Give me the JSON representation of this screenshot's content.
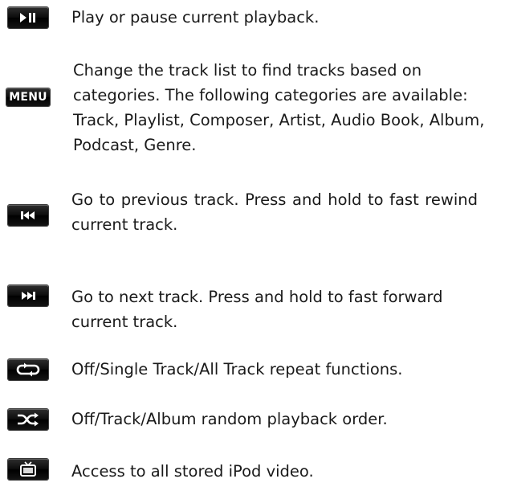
{
  "items": [
    {
      "key": "play_pause",
      "icon": "play-pause-icon",
      "text": "Play or pause current playback."
    },
    {
      "key": "menu",
      "icon": "menu-icon",
      "icon_label": "MENU",
      "text_line1": "Change the track list to find tracks based on",
      "text_rest": "categories. The following categories are available: Track, Playlist, Composer, Artist, Audio Book, Album, Podcast, Genre."
    },
    {
      "key": "previous",
      "icon": "previous-track-icon",
      "text": "Go to previous track. Press and hold to fast rewind current track."
    },
    {
      "key": "next",
      "icon": "next-track-icon",
      "text": "Go to next track. Press and hold to fast forward current track."
    },
    {
      "key": "repeat",
      "icon": "repeat-icon",
      "text": "Off/Single Track/All Track repeat functions."
    },
    {
      "key": "shuffle",
      "icon": "shuffle-icon",
      "text": "Off/Track/Album random playback order."
    },
    {
      "key": "video",
      "icon": "tv-video-icon",
      "text": "Access to all stored iPod video."
    }
  ],
  "colors": {
    "icon_background": "#000000",
    "icon_foreground": "#ffffff",
    "text": "#1a1a1a",
    "page_background": "#ffffff"
  }
}
